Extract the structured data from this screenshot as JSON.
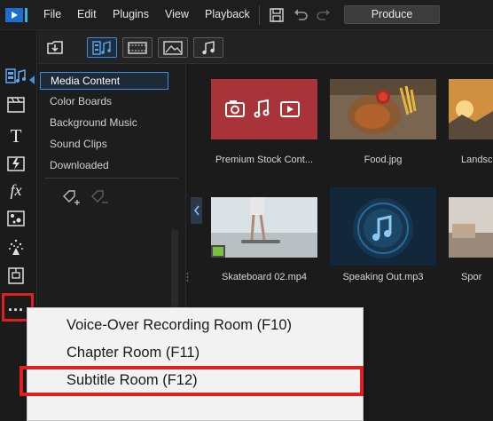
{
  "menu": {
    "items": [
      "File",
      "Edit",
      "Plugins",
      "View",
      "Playback"
    ],
    "produce_label": "Produce"
  },
  "left_toolbar": {
    "tools": [
      "media-room-icon",
      "fx-room-icon",
      "title-room-icon",
      "transition-room-icon",
      "fx-icon",
      "pip-icon",
      "particle-icon",
      "subtitle-icon",
      "more-icon"
    ]
  },
  "sub_toolbar": {
    "buttons": [
      "import-media-icon",
      "video-audio-filter-icon",
      "video-filter-icon",
      "image-filter-icon",
      "audio-filter-icon"
    ]
  },
  "categories": [
    {
      "label": "Media Content",
      "selected": true
    },
    {
      "label": "Color Boards",
      "selected": false
    },
    {
      "label": "Background Music",
      "selected": false
    },
    {
      "label": "Sound Clips",
      "selected": false
    },
    {
      "label": "Downloaded",
      "selected": false
    }
  ],
  "media": [
    {
      "label": "Premium Stock Cont..."
    },
    {
      "label": "Food.jpg"
    },
    {
      "label": "Landsc"
    },
    {
      "label": "Skateboard 02.mp4"
    },
    {
      "label": "Speaking Out.mp3"
    },
    {
      "label": "Spor"
    }
  ],
  "more_button_label": "...",
  "popup": {
    "items": [
      "Voice-Over Recording Room (F10)",
      "Chapter Room (F11)",
      "Subtitle Room (F12)"
    ],
    "highlighted_index": 2
  },
  "colors": {
    "accent": "#3a8ee6",
    "highlight": "#e02020",
    "premium_tile": "#a8343a"
  }
}
